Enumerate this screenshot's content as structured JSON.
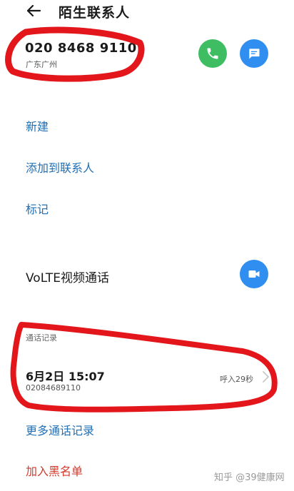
{
  "header": {
    "title": "陌生联系人",
    "back_icon": "back-arrow-icon"
  },
  "contact": {
    "number": "020 8468 9110",
    "location": "广东广州",
    "call_icon": "phone-icon",
    "sms_icon": "message-icon",
    "call_color": "#3ebd63",
    "sms_color": "#2f8ef0"
  },
  "actions": {
    "new": "新建",
    "add_to_contacts": "添加到联系人",
    "mark": "标记"
  },
  "volte": {
    "label": "VoLTE视频通话",
    "icon": "video-camera-icon"
  },
  "call_log": {
    "section_label": "通话记录",
    "entries": [
      {
        "time": "6月2日 15:07",
        "number": "02084689110",
        "duration": "呼入29秒"
      }
    ],
    "more": "更多通话记录"
  },
  "block": {
    "label": "加入黑名单",
    "color": "#d33a2c"
  },
  "watermark": "知乎 @39健康网",
  "colors": {
    "link": "#1f6fb6",
    "annotation": "#e3161b"
  }
}
